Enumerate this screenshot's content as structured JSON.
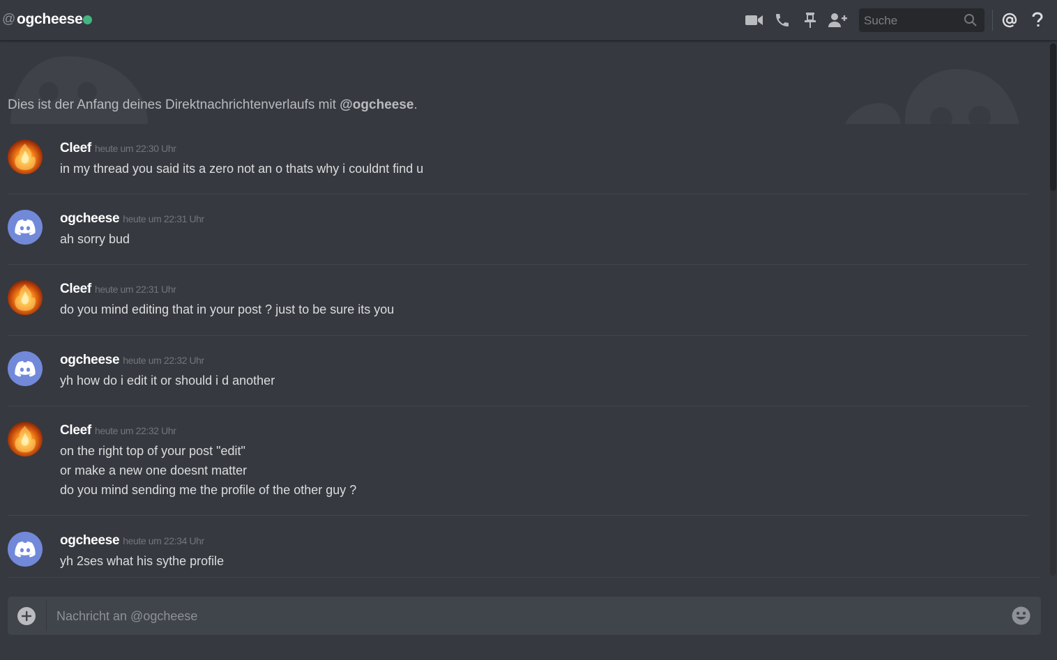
{
  "header": {
    "at_symbol": "@",
    "channel_name": "ogcheese",
    "status_color": "#43b581",
    "icons": [
      "video-call-icon",
      "voice-call-icon",
      "pinned-messages-icon",
      "add-friend-icon",
      "mentions-icon",
      "help-icon"
    ],
    "search_placeholder": "Suche"
  },
  "intro": {
    "text": "Dies ist der Anfang deines Direktnachrichtenverlaufs mit ",
    "mention": "@ogcheese",
    "end": "."
  },
  "messages": [
    {
      "author": "Cleef",
      "timestamp": "heute um 22:30 Uhr",
      "avatar": "fire-avatar",
      "lines": [
        "in my thread you said its a zero not an o thats why  i couldnt find u"
      ]
    },
    {
      "author": "ogcheese",
      "timestamp": "heute um 22:31 Uhr",
      "avatar": "discord-default-avatar",
      "lines": [
        "ah sorry bud"
      ]
    },
    {
      "author": "Cleef",
      "timestamp": "heute um 22:31 Uhr",
      "avatar": "fire-avatar",
      "lines": [
        "do you mind editing that in your post ? just to be sure its you"
      ]
    },
    {
      "author": "ogcheese",
      "timestamp": "heute um 22:32 Uhr",
      "avatar": "discord-default-avatar",
      "lines": [
        "yh how do i edit it or should i d another"
      ]
    },
    {
      "author": "Cleef",
      "timestamp": "heute um 22:32 Uhr",
      "avatar": "fire-avatar",
      "lines": [
        "on the right top of your post \"edit\"",
        "or make a new one doesnt matter",
        "do you mind sending me the profile of the other guy ?"
      ]
    },
    {
      "author": "ogcheese",
      "timestamp": "heute um 22:34 Uhr",
      "avatar": "discord-default-avatar",
      "lines": [
        "yh 2ses what his sythe profile"
      ]
    }
  ],
  "composer": {
    "placeholder": "Nachricht an @ogcheese",
    "icons": [
      "add-attachment-icon",
      "emoji-icon"
    ]
  },
  "colors": {
    "background": "#36393f",
    "input_background": "#40444b",
    "blurple": "#7289da",
    "online": "#43b581"
  }
}
